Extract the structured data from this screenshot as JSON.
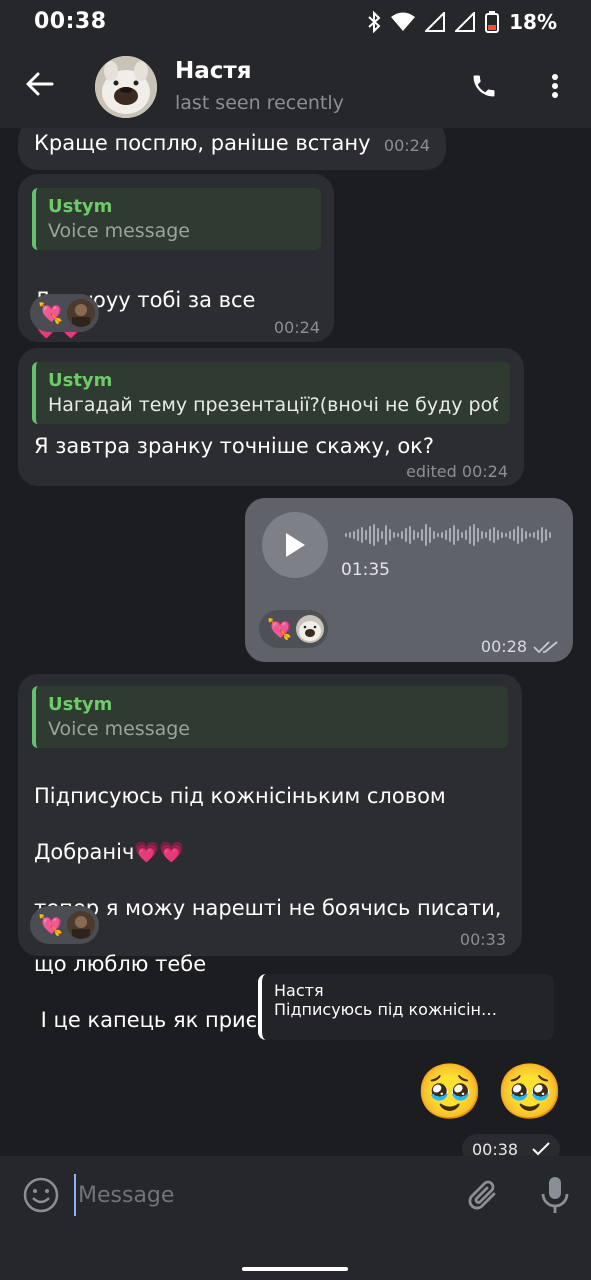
{
  "status_bar": {
    "time": "00:38",
    "battery": "18%"
  },
  "header": {
    "contact_name": "Настя",
    "contact_status": "last seen recently"
  },
  "messages": [
    {
      "direction": "incoming",
      "text": "Краще посплю, раніше встану",
      "time": "00:24"
    },
    {
      "direction": "incoming",
      "reply_author": "Ustym",
      "reply_text": "Voice message",
      "text": "Дякуюуу тобі за все",
      "text_emoji": "💗💗",
      "reaction_emoji": "💘",
      "time": "00:24"
    },
    {
      "direction": "incoming",
      "reply_author": "Ustym",
      "reply_text": "Нагадай тему презентації?(вночі не буду роб…",
      "text": "Я завтра зранку точніше скажу, ок?",
      "time": "edited 00:24"
    },
    {
      "direction": "outgoing",
      "type": "voice",
      "duration": "01:35",
      "reaction_emoji": "💘",
      "time": "00:28",
      "status": "read"
    },
    {
      "direction": "incoming",
      "reply_author": "Ustym",
      "reply_text": "Voice message",
      "line1": "Підписуюсь під кожнісіньким словом",
      "line2": "Добраніч",
      "line2_emoji": "💗💗",
      "line3": "тепер я можу нарешті не боячись писати,",
      "line4": "що люблю тебе",
      "line5": " І це капець як приємно",
      "reaction_emoji": "💘",
      "time": "00:33"
    },
    {
      "direction": "outgoing",
      "reply_author": "Настя",
      "reply_text": "Підписуюсь під кожнісін…",
      "emoji_1": "🥹",
      "emoji_2": "🥹",
      "time": "00:38",
      "status": "sent"
    }
  ],
  "composer": {
    "placeholder": "Message"
  },
  "icons": {
    "back": "arrow-left-icon",
    "call": "phone-icon",
    "menu": "more-vertical-icon",
    "emoji": "smile-icon",
    "attach": "paperclip-icon",
    "mic": "microphone-icon",
    "play": "play-icon"
  },
  "colors": {
    "background": "#1c1d20",
    "bar": "#26272b",
    "incoming_bubble": "#2c2d31",
    "outgoing_bubble": "#5f6369",
    "quote_accent": "#62c46a"
  }
}
